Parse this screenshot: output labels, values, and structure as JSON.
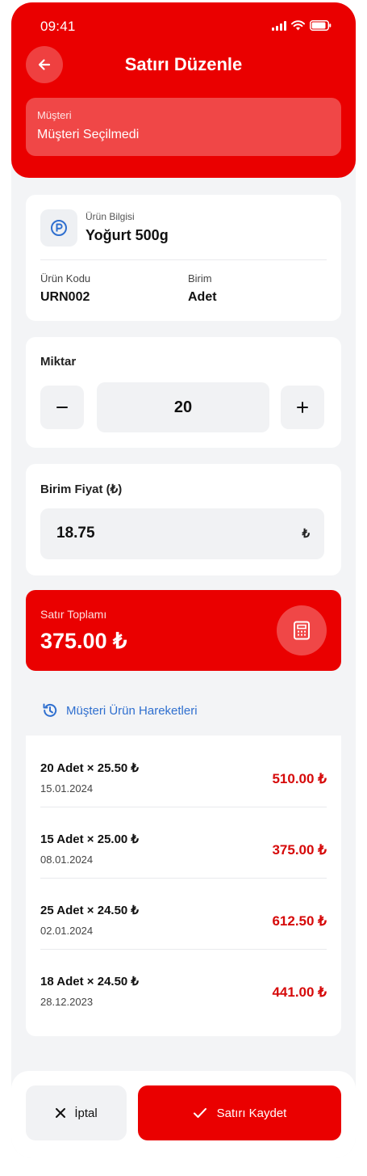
{
  "status_bar": {
    "time": "09:41"
  },
  "header": {
    "title": "Satırı Düzenle",
    "customer_label": "Müşteri",
    "customer_value": "Müşteri Seçilmedi"
  },
  "product": {
    "label": "Ürün Bilgisi",
    "name": "Yoğurt 500g",
    "code_label": "Ürün Kodu",
    "code_value": "URN002",
    "unit_label": "Birim",
    "unit_value": "Adet"
  },
  "quantity": {
    "label": "Miktar",
    "value": "20",
    "decrement": "−",
    "increment": "+"
  },
  "price": {
    "label": "Birim Fiyat (₺)",
    "value": "18.75",
    "currency": "₺"
  },
  "total": {
    "label": "Satır Toplamı",
    "value": "375.00 ₺"
  },
  "history": {
    "link_label": "Müşteri Ürün Hareketleri",
    "rows": [
      {
        "qty_price": "20 Adet × 25.50 ₺",
        "date": "15.01.2024",
        "amount": "510.00 ₺"
      },
      {
        "qty_price": "15 Adet × 25.00 ₺",
        "date": "08.01.2024",
        "amount": "375.00 ₺"
      },
      {
        "qty_price": "25 Adet × 24.50 ₺",
        "date": "02.01.2024",
        "amount": "612.50 ₺"
      },
      {
        "qty_price": "18 Adet × 24.50 ₺",
        "date": "28.12.2023",
        "amount": "441.00 ₺"
      }
    ]
  },
  "actions": {
    "cancel_label": "İptal",
    "save_label": "Satırı Kaydet"
  },
  "colors": {
    "accent": "#ea0000",
    "amount": "#d60a0a",
    "link": "#2f6fcf",
    "background": "#f3f4f6"
  }
}
